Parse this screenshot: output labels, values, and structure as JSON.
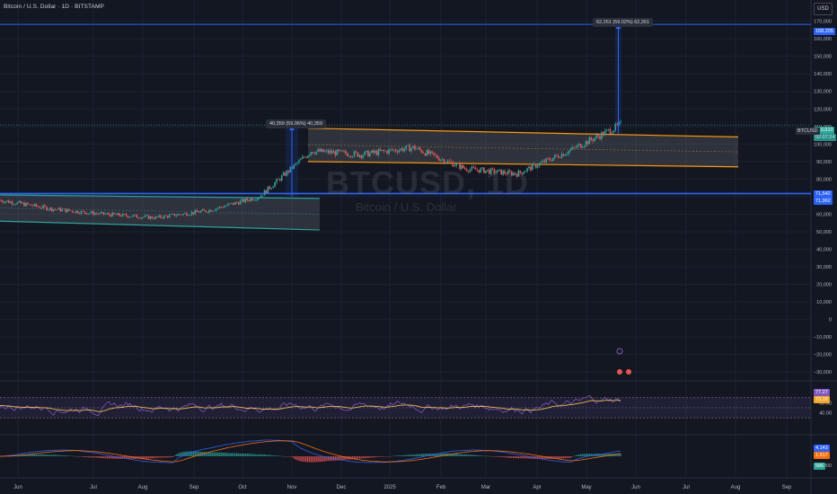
{
  "header": {
    "symbol_line": "Bitcoin / U.S. Dollar · 1D · BITSTAMP",
    "currency": "USD"
  },
  "watermark": {
    "ticker": "BTCUSD, 1D",
    "name": "Bitcoin / U.S. Dollar"
  },
  "annotations": {
    "measure_1": "40,359 (59.06%) 40,359",
    "measure_2": "62,261 (59.02%) 62,261"
  },
  "price_tags": {
    "target": "168,205",
    "current": "110,910",
    "countdown": "02:07:24",
    "ticker": "BTCUSD",
    "level_1": "71,542",
    "level_2": "71,962"
  },
  "rsi_tags": {
    "rsi": "77.27",
    "rsi_ma": "73.16"
  },
  "macd_tags": {
    "macd": "4,143",
    "signal": "1,617",
    "hist": "586"
  },
  "colors": {
    "background": "#131722",
    "grid": "#1e222d",
    "up": "#26a69a",
    "down": "#ef5350",
    "blue": "#2962ff",
    "orange": "#ff9800",
    "rsi_line": "#7e57c2",
    "rsi_ma": "#f5b942"
  },
  "chart_data": [
    {
      "type": "candlestick",
      "title": "Bitcoin / U.S. Dollar · 1D · BITSTAMP",
      "x_axis_labels": [
        "Jun",
        "Jul",
        "Aug",
        "Sep",
        "Oct",
        "Nov",
        "Dec",
        "2025",
        "Feb",
        "Mar",
        "Apr",
        "May",
        "Jun",
        "Jul",
        "Aug",
        "Sep"
      ],
      "y_axis_labels": [
        "170,000",
        "160,000",
        "150,000",
        "140,000",
        "130,000",
        "120,000",
        "110,000",
        "100,000",
        "90,000",
        "80,000",
        "70,000",
        "60,000",
        "50,000",
        "40,000",
        "30,000",
        "20,000",
        "10,000",
        "0",
        "−10,000",
        "−20,000",
        "−30,000"
      ],
      "ylim": [
        -35000,
        178000
      ],
      "approx_close_by_month": [
        {
          "x": "Jun",
          "close": 68000
        },
        {
          "x": "Jul",
          "close": 63000
        },
        {
          "x": "Aug",
          "close": 60000
        },
        {
          "x": "Sep",
          "close": 58000
        },
        {
          "x": "Oct",
          "close": 62000
        },
        {
          "x": "Nov",
          "close": 70000
        },
        {
          "x": "Dec",
          "close": 96000
        },
        {
          "x": "2025",
          "close": 94000
        },
        {
          "x": "Feb",
          "close": 98000
        },
        {
          "x": "Mar",
          "close": 86000
        },
        {
          "x": "Apr",
          "close": 83000
        },
        {
          "x": "May",
          "close": 96000
        },
        {
          "x": "May end",
          "close": 110910
        }
      ],
      "lower_channel": {
        "upper": [
          71000,
          69000
        ],
        "lower": [
          56000,
          51000
        ],
        "span": [
          "start",
          "Nov"
        ]
      },
      "upper_channel": {
        "upper": [
          109000,
          104000
        ],
        "lower": [
          90000,
          87000
        ],
        "span": [
          "Nov",
          "Jun"
        ]
      },
      "measure_1": {
        "from": 70000,
        "to": 110400,
        "text": "40,359 (59.06%) 40,359"
      },
      "measure_2": {
        "from": 106000,
        "to": 168205,
        "text": "62,261 (59.02%) 62,261"
      },
      "horizontal_lines": [
        168205,
        71542,
        71962
      ]
    },
    {
      "type": "line",
      "name": "RSI",
      "y_axis_labels": [
        "60.00",
        "40.00"
      ],
      "band": [
        30,
        70
      ],
      "last_rsi": 77.27,
      "last_rsi_ma": 73.16
    },
    {
      "type": "bar",
      "name": "MACD",
      "y_axis_labels": [
        "−4,000"
      ],
      "last_macd": 4143,
      "last_signal": 1617,
      "last_hist": 586
    }
  ]
}
